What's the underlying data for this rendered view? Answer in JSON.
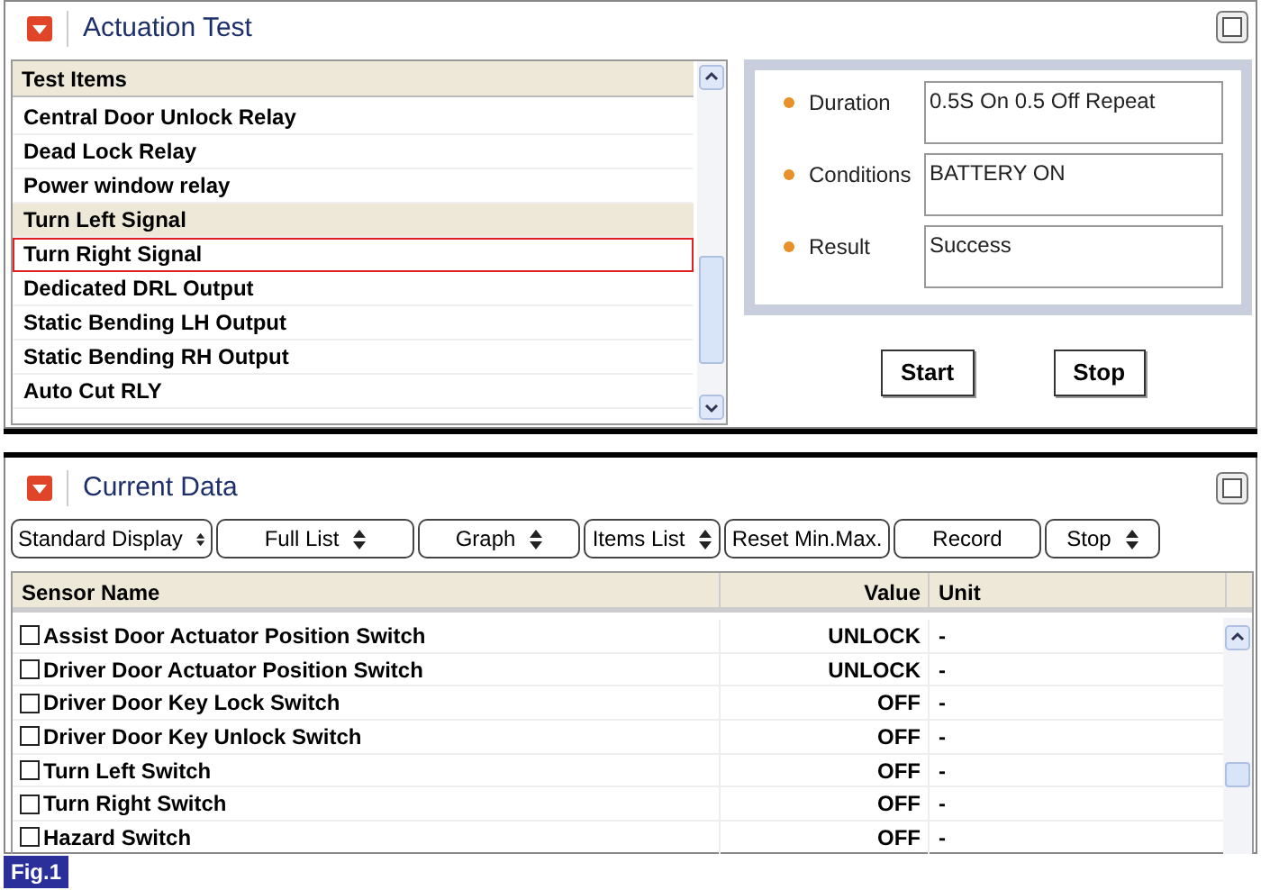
{
  "actuation_test": {
    "title": "Actuation Test",
    "list_header": "Test Items",
    "items": [
      {
        "label": "Central Door Unlock Relay",
        "selected": false,
        "focused": false
      },
      {
        "label": "Dead Lock Relay",
        "selected": false,
        "focused": false
      },
      {
        "label": "Power window relay",
        "selected": false,
        "focused": false
      },
      {
        "label": "Turn Left Signal",
        "selected": true,
        "focused": false
      },
      {
        "label": "Turn Right Signal",
        "selected": false,
        "focused": true
      },
      {
        "label": "Dedicated DRL Output",
        "selected": false,
        "focused": false
      },
      {
        "label": "Static Bending LH Output",
        "selected": false,
        "focused": false
      },
      {
        "label": "Static Bending RH Output",
        "selected": false,
        "focused": false
      },
      {
        "label": "Auto Cut RLY",
        "selected": false,
        "focused": false
      }
    ],
    "details": [
      {
        "label": "Duration",
        "value": "0.5S On 0.5 Off Repeat"
      },
      {
        "label": "Conditions",
        "value": "BATTERY ON"
      },
      {
        "label": "Result",
        "value": "Success"
      }
    ],
    "buttons": [
      "Start",
      "Stop"
    ]
  },
  "current_data": {
    "title": "Current Data",
    "toolbar": [
      {
        "label": "Standard Display",
        "kind": "dropdown"
      },
      {
        "label": "Full List",
        "kind": "dropdown"
      },
      {
        "label": "Graph",
        "kind": "dropdown"
      },
      {
        "label": "Items List",
        "kind": "dropdown"
      },
      {
        "label": "Reset Min.Max.",
        "kind": "button"
      },
      {
        "label": "Record",
        "kind": "button"
      },
      {
        "label": "Stop",
        "kind": "dropdown"
      }
    ],
    "columns": [
      "Sensor Name",
      "Value",
      "Unit"
    ],
    "rows": [
      {
        "name": "Assist Door Actuator Position Switch",
        "value": "UNLOCK",
        "unit": "-",
        "checked": false
      },
      {
        "name": "Driver Door Actuator Position Switch",
        "value": "UNLOCK",
        "unit": "-",
        "checked": false
      },
      {
        "name": "Driver Door Key Lock Switch",
        "value": "OFF",
        "unit": "-",
        "checked": false
      },
      {
        "name": "Driver Door Key Unlock Switch",
        "value": "OFF",
        "unit": "-",
        "checked": false
      },
      {
        "name": "Turn Left Switch",
        "value": "OFF",
        "unit": "-",
        "checked": false
      },
      {
        "name": "Turn Right Switch",
        "value": "OFF",
        "unit": "-",
        "checked": false
      },
      {
        "name": "Hazard Switch",
        "value": "OFF",
        "unit": "-",
        "checked": false
      }
    ]
  },
  "figure_label": "Fig.1"
}
